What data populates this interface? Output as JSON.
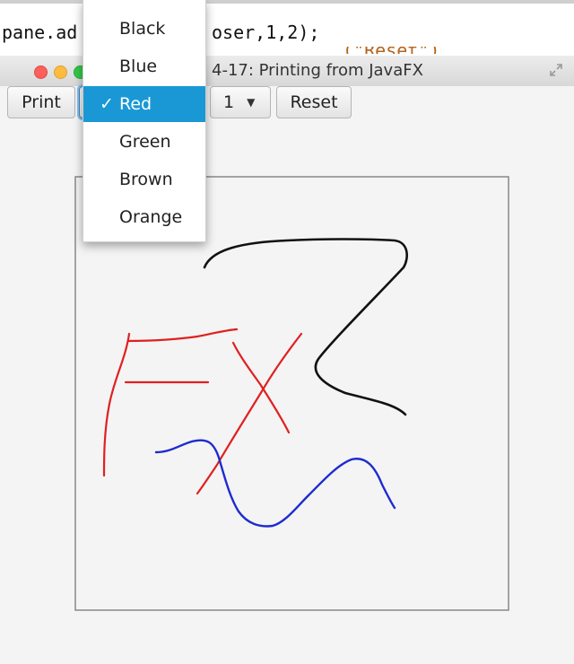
{
  "code_editor": {
    "line_left": "pane.ad",
    "line_right": "oser,1,2);",
    "line_below": "(\"Reset\")"
  },
  "window": {
    "title": "4-17: Printing from JavaFX"
  },
  "toolbar": {
    "print_label": "Print",
    "width_value": "1",
    "width_arrow": "▼",
    "reset_label": "Reset"
  },
  "color_menu": {
    "items": [
      {
        "label": "Black",
        "selected": false
      },
      {
        "label": "Blue",
        "selected": false
      },
      {
        "label": "Red",
        "selected": true
      },
      {
        "label": "Green",
        "selected": false
      },
      {
        "label": "Brown",
        "selected": false
      },
      {
        "label": "Orange",
        "selected": false
      }
    ],
    "check_mark": "✓"
  },
  "colors": {
    "selection": "#1a98d6",
    "stroke_black": "#111111",
    "stroke_red": "#e02020",
    "stroke_blue": "#1e2bd0"
  }
}
